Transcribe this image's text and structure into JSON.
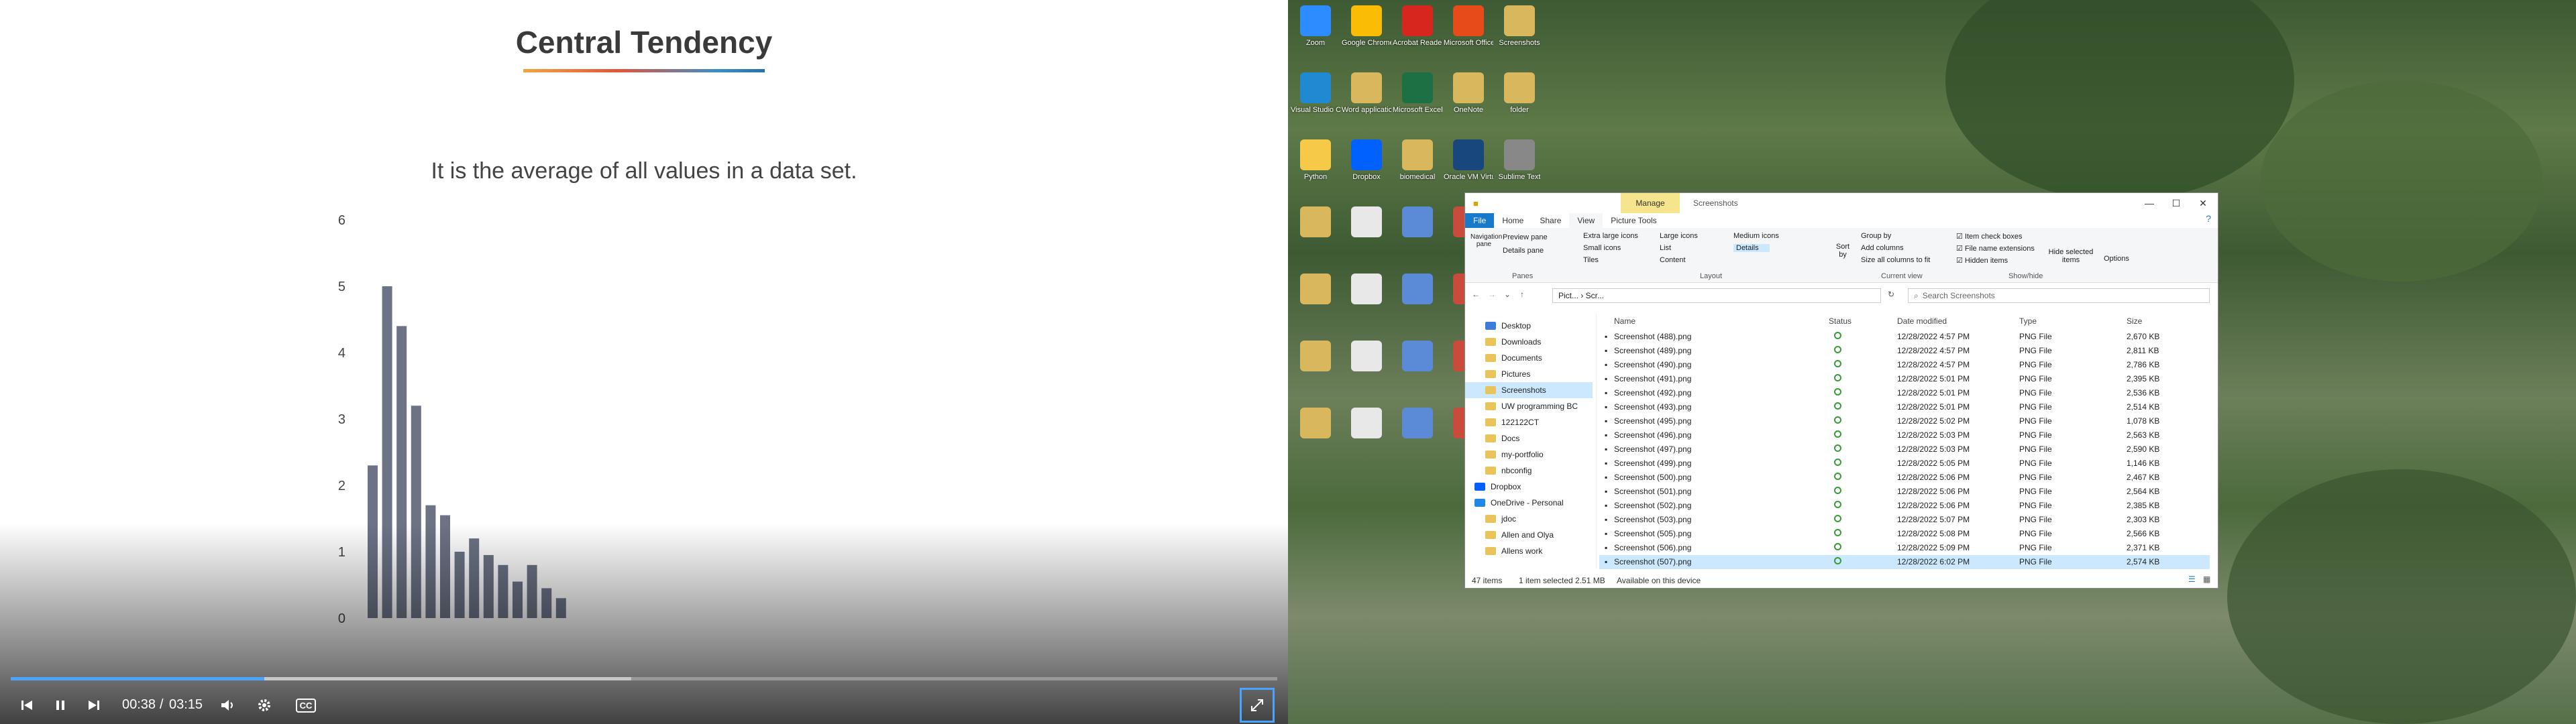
{
  "slide": {
    "title": "Central Tendency",
    "text": "It is the average of all values in a data set."
  },
  "chart_data": {
    "type": "bar",
    "yticks": [
      "0",
      "1",
      "2",
      "3",
      "4",
      "5",
      "6"
    ],
    "ylim": [
      0,
      6
    ],
    "values": [
      2.3,
      5.0,
      4.4,
      3.2,
      1.7,
      1.55,
      1.0,
      1.2,
      0.95,
      0.8,
      0.55,
      0.8,
      0.45,
      0.3
    ],
    "color": "#6b7385"
  },
  "player": {
    "time_current": "00:38",
    "time_sep": "/",
    "time_total": "03:15",
    "progress": 0.2,
    "buffered": 0.49,
    "prev_icon": "skip-previous-icon",
    "pause_icon": "pause-icon",
    "next_icon": "skip-next-icon",
    "volume_icon": "volume-icon",
    "settings_icon": "gear-icon",
    "cc_label": "CC",
    "expand_icon": "expand-icon"
  },
  "desktop_icons": [
    {
      "label": "Zoom",
      "color": "#2d8cff"
    },
    {
      "label": "Google Chrome",
      "color": "#fbbc05"
    },
    {
      "label": "Acrobat Reader",
      "color": "#d7261e"
    },
    {
      "label": "Microsoft Office",
      "color": "#e74b1a"
    },
    {
      "label": "Screenshots",
      "color": "#d9b75c"
    },
    {
      "label": "Visual Studio Code",
      "color": "#1f8ad2"
    },
    {
      "label": "Word application",
      "color": "#d9b75c"
    },
    {
      "label": "Microsoft Excel",
      "color": "#1d7044"
    },
    {
      "label": "OneNote",
      "color": "#d9b75c"
    },
    {
      "label": "folder",
      "color": "#d9b75c"
    },
    {
      "label": "Python",
      "color": "#f7c948"
    },
    {
      "label": "Dropbox",
      "color": "#0061ff"
    },
    {
      "label": "biomedical",
      "color": "#d9b75c"
    },
    {
      "label": "Oracle VM VirtualBox",
      "color": "#18477e"
    },
    {
      "label": "Sublime Text",
      "color": "#888"
    }
  ],
  "explorer": {
    "title": "Screenshots",
    "manage_tab": "Manage",
    "tabs": [
      "File",
      "Home",
      "Share",
      "View",
      "Picture Tools"
    ],
    "ribbon": {
      "nav_pane": "Navigation pane",
      "preview_pane": "Preview pane",
      "details_pane": "Details pane",
      "xl_icons": "Extra large icons",
      "large_icons": "Large icons",
      "medium_icons": "Medium icons",
      "small_icons": "Small icons",
      "list": "List",
      "details": "Details",
      "tiles": "Tiles",
      "content": "Content",
      "sort_by": "Sort by",
      "group_by": "Group by",
      "add_columns": "Add columns",
      "size_all": "Size all columns to fit",
      "item_checkboxes": "Item check boxes",
      "file_ext": "File name extensions",
      "hidden_items": "Hidden items",
      "hide_selected": "Hide selected items",
      "options": "Options",
      "g_panes": "Panes",
      "g_layout": "Layout",
      "g_current": "Current view",
      "g_showhide": "Show/hide"
    },
    "address": "Pict... › Scr...",
    "search_placeholder": "Search Screenshots",
    "nav": [
      "Desktop",
      "Downloads",
      "Documents",
      "Pictures",
      "Screenshots",
      "UW programming BC",
      "122122CT",
      "Docs",
      "my-portfolio",
      "nbconfig",
      "Dropbox",
      "OneDrive - Personal",
      "jdoc",
      "Allen and Olya",
      "Allens work"
    ],
    "columns": {
      "name": "Name",
      "status": "Status",
      "date": "Date modified",
      "type": "Type",
      "size": "Size"
    },
    "files": [
      {
        "name": "Screenshot (488).png",
        "date": "12/28/2022 4:57 PM",
        "type": "PNG File",
        "size": "2,670 KB"
      },
      {
        "name": "Screenshot (489).png",
        "date": "12/28/2022 4:57 PM",
        "type": "PNG File",
        "size": "2,811 KB"
      },
      {
        "name": "Screenshot (490).png",
        "date": "12/28/2022 4:57 PM",
        "type": "PNG File",
        "size": "2,786 KB"
      },
      {
        "name": "Screenshot (491).png",
        "date": "12/28/2022 5:01 PM",
        "type": "PNG File",
        "size": "2,395 KB"
      },
      {
        "name": "Screenshot (492).png",
        "date": "12/28/2022 5:01 PM",
        "type": "PNG File",
        "size": "2,536 KB"
      },
      {
        "name": "Screenshot (493).png",
        "date": "12/28/2022 5:01 PM",
        "type": "PNG File",
        "size": "2,514 KB"
      },
      {
        "name": "Screenshot (495).png",
        "date": "12/28/2022 5:02 PM",
        "type": "PNG File",
        "size": "1,078 KB"
      },
      {
        "name": "Screenshot (496).png",
        "date": "12/28/2022 5:03 PM",
        "type": "PNG File",
        "size": "2,563 KB"
      },
      {
        "name": "Screenshot (497).png",
        "date": "12/28/2022 5:03 PM",
        "type": "PNG File",
        "size": "2,590 KB"
      },
      {
        "name": "Screenshot (499).png",
        "date": "12/28/2022 5:05 PM",
        "type": "PNG File",
        "size": "1,146 KB"
      },
      {
        "name": "Screenshot (500).png",
        "date": "12/28/2022 5:06 PM",
        "type": "PNG File",
        "size": "2,467 KB"
      },
      {
        "name": "Screenshot (501).png",
        "date": "12/28/2022 5:06 PM",
        "type": "PNG File",
        "size": "2,564 KB"
      },
      {
        "name": "Screenshot (502).png",
        "date": "12/28/2022 5:06 PM",
        "type": "PNG File",
        "size": "2,385 KB"
      },
      {
        "name": "Screenshot (503).png",
        "date": "12/28/2022 5:07 PM",
        "type": "PNG File",
        "size": "2,303 KB"
      },
      {
        "name": "Screenshot (505).png",
        "date": "12/28/2022 5:08 PM",
        "type": "PNG File",
        "size": "2,566 KB"
      },
      {
        "name": "Screenshot (506).png",
        "date": "12/28/2022 5:09 PM",
        "type": "PNG File",
        "size": "2,371 KB"
      },
      {
        "name": "Screenshot (507).png",
        "date": "12/28/2022 6:02 PM",
        "type": "PNG File",
        "size": "2,574 KB"
      }
    ],
    "status": {
      "items": "47 items",
      "selected": "1 item selected  2.51 MB",
      "availability": "Available on this device"
    }
  }
}
